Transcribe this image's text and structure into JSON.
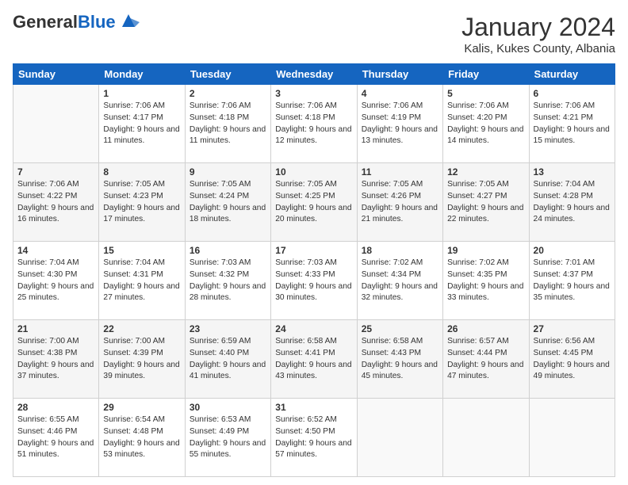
{
  "header": {
    "logo_general": "General",
    "logo_blue": "Blue",
    "month_title": "January 2024",
    "location": "Kalis, Kukes County, Albania"
  },
  "days_of_week": [
    "Sunday",
    "Monday",
    "Tuesday",
    "Wednesday",
    "Thursday",
    "Friday",
    "Saturday"
  ],
  "weeks": [
    [
      {
        "day": "",
        "sunrise": "",
        "sunset": "",
        "daylight": ""
      },
      {
        "day": "1",
        "sunrise": "Sunrise: 7:06 AM",
        "sunset": "Sunset: 4:17 PM",
        "daylight": "Daylight: 9 hours and 11 minutes."
      },
      {
        "day": "2",
        "sunrise": "Sunrise: 7:06 AM",
        "sunset": "Sunset: 4:18 PM",
        "daylight": "Daylight: 9 hours and 11 minutes."
      },
      {
        "day": "3",
        "sunrise": "Sunrise: 7:06 AM",
        "sunset": "Sunset: 4:18 PM",
        "daylight": "Daylight: 9 hours and 12 minutes."
      },
      {
        "day": "4",
        "sunrise": "Sunrise: 7:06 AM",
        "sunset": "Sunset: 4:19 PM",
        "daylight": "Daylight: 9 hours and 13 minutes."
      },
      {
        "day": "5",
        "sunrise": "Sunrise: 7:06 AM",
        "sunset": "Sunset: 4:20 PM",
        "daylight": "Daylight: 9 hours and 14 minutes."
      },
      {
        "day": "6",
        "sunrise": "Sunrise: 7:06 AM",
        "sunset": "Sunset: 4:21 PM",
        "daylight": "Daylight: 9 hours and 15 minutes."
      }
    ],
    [
      {
        "day": "7",
        "sunrise": "Sunrise: 7:06 AM",
        "sunset": "Sunset: 4:22 PM",
        "daylight": "Daylight: 9 hours and 16 minutes."
      },
      {
        "day": "8",
        "sunrise": "Sunrise: 7:05 AM",
        "sunset": "Sunset: 4:23 PM",
        "daylight": "Daylight: 9 hours and 17 minutes."
      },
      {
        "day": "9",
        "sunrise": "Sunrise: 7:05 AM",
        "sunset": "Sunset: 4:24 PM",
        "daylight": "Daylight: 9 hours and 18 minutes."
      },
      {
        "day": "10",
        "sunrise": "Sunrise: 7:05 AM",
        "sunset": "Sunset: 4:25 PM",
        "daylight": "Daylight: 9 hours and 20 minutes."
      },
      {
        "day": "11",
        "sunrise": "Sunrise: 7:05 AM",
        "sunset": "Sunset: 4:26 PM",
        "daylight": "Daylight: 9 hours and 21 minutes."
      },
      {
        "day": "12",
        "sunrise": "Sunrise: 7:05 AM",
        "sunset": "Sunset: 4:27 PM",
        "daylight": "Daylight: 9 hours and 22 minutes."
      },
      {
        "day": "13",
        "sunrise": "Sunrise: 7:04 AM",
        "sunset": "Sunset: 4:28 PM",
        "daylight": "Daylight: 9 hours and 24 minutes."
      }
    ],
    [
      {
        "day": "14",
        "sunrise": "Sunrise: 7:04 AM",
        "sunset": "Sunset: 4:30 PM",
        "daylight": "Daylight: 9 hours and 25 minutes."
      },
      {
        "day": "15",
        "sunrise": "Sunrise: 7:04 AM",
        "sunset": "Sunset: 4:31 PM",
        "daylight": "Daylight: 9 hours and 27 minutes."
      },
      {
        "day": "16",
        "sunrise": "Sunrise: 7:03 AM",
        "sunset": "Sunset: 4:32 PM",
        "daylight": "Daylight: 9 hours and 28 minutes."
      },
      {
        "day": "17",
        "sunrise": "Sunrise: 7:03 AM",
        "sunset": "Sunset: 4:33 PM",
        "daylight": "Daylight: 9 hours and 30 minutes."
      },
      {
        "day": "18",
        "sunrise": "Sunrise: 7:02 AM",
        "sunset": "Sunset: 4:34 PM",
        "daylight": "Daylight: 9 hours and 32 minutes."
      },
      {
        "day": "19",
        "sunrise": "Sunrise: 7:02 AM",
        "sunset": "Sunset: 4:35 PM",
        "daylight": "Daylight: 9 hours and 33 minutes."
      },
      {
        "day": "20",
        "sunrise": "Sunrise: 7:01 AM",
        "sunset": "Sunset: 4:37 PM",
        "daylight": "Daylight: 9 hours and 35 minutes."
      }
    ],
    [
      {
        "day": "21",
        "sunrise": "Sunrise: 7:00 AM",
        "sunset": "Sunset: 4:38 PM",
        "daylight": "Daylight: 9 hours and 37 minutes."
      },
      {
        "day": "22",
        "sunrise": "Sunrise: 7:00 AM",
        "sunset": "Sunset: 4:39 PM",
        "daylight": "Daylight: 9 hours and 39 minutes."
      },
      {
        "day": "23",
        "sunrise": "Sunrise: 6:59 AM",
        "sunset": "Sunset: 4:40 PM",
        "daylight": "Daylight: 9 hours and 41 minutes."
      },
      {
        "day": "24",
        "sunrise": "Sunrise: 6:58 AM",
        "sunset": "Sunset: 4:41 PM",
        "daylight": "Daylight: 9 hours and 43 minutes."
      },
      {
        "day": "25",
        "sunrise": "Sunrise: 6:58 AM",
        "sunset": "Sunset: 4:43 PM",
        "daylight": "Daylight: 9 hours and 45 minutes."
      },
      {
        "day": "26",
        "sunrise": "Sunrise: 6:57 AM",
        "sunset": "Sunset: 4:44 PM",
        "daylight": "Daylight: 9 hours and 47 minutes."
      },
      {
        "day": "27",
        "sunrise": "Sunrise: 6:56 AM",
        "sunset": "Sunset: 4:45 PM",
        "daylight": "Daylight: 9 hours and 49 minutes."
      }
    ],
    [
      {
        "day": "28",
        "sunrise": "Sunrise: 6:55 AM",
        "sunset": "Sunset: 4:46 PM",
        "daylight": "Daylight: 9 hours and 51 minutes."
      },
      {
        "day": "29",
        "sunrise": "Sunrise: 6:54 AM",
        "sunset": "Sunset: 4:48 PM",
        "daylight": "Daylight: 9 hours and 53 minutes."
      },
      {
        "day": "30",
        "sunrise": "Sunrise: 6:53 AM",
        "sunset": "Sunset: 4:49 PM",
        "daylight": "Daylight: 9 hours and 55 minutes."
      },
      {
        "day": "31",
        "sunrise": "Sunrise: 6:52 AM",
        "sunset": "Sunset: 4:50 PM",
        "daylight": "Daylight: 9 hours and 57 minutes."
      },
      {
        "day": "",
        "sunrise": "",
        "sunset": "",
        "daylight": ""
      },
      {
        "day": "",
        "sunrise": "",
        "sunset": "",
        "daylight": ""
      },
      {
        "day": "",
        "sunrise": "",
        "sunset": "",
        "daylight": ""
      }
    ]
  ]
}
